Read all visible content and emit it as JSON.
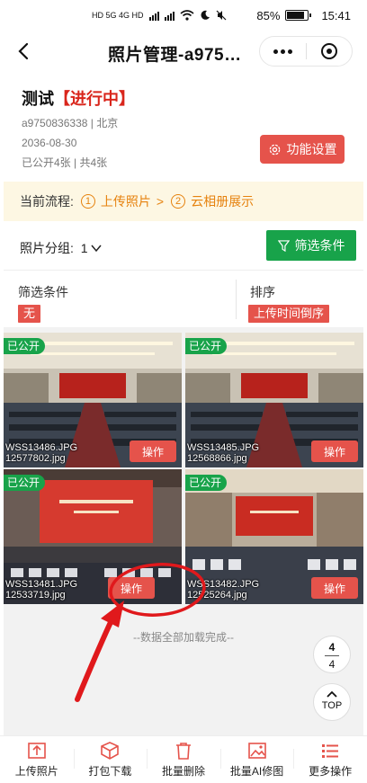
{
  "status_bar": {
    "network_left": "HD 5G 4G HD",
    "battery": "85%",
    "time": "15:41"
  },
  "nav": {
    "title": "照片管理-a975…",
    "back_icon": "chevron-left-icon",
    "more_icon": "more-dots-icon",
    "close_icon": "mini-program-close-icon"
  },
  "album": {
    "name": "测试",
    "state": "【进行中】",
    "id_location": "a9750836338 | 北京",
    "date": "2036-08-30",
    "counts": "已公开4张 | 共4张",
    "settings_label": "功能设置"
  },
  "flow": {
    "label": "当前流程:",
    "step1_num": "1",
    "step1": "上传照片",
    "arrow": ">",
    "step2_num": "2",
    "step2": "云相册展示"
  },
  "group": {
    "label": "照片分组:",
    "value": "1",
    "filter_label": "筛选条件"
  },
  "filter_header": {
    "filter_title": "筛选条件",
    "filter_value": "无",
    "sort_title": "排序",
    "sort_value": "上传时间倒序"
  },
  "photos": [
    {
      "status": "已公开",
      "line1": "WSS13486.JPG",
      "line2": "12577802.jpg",
      "action": "操作"
    },
    {
      "status": "已公开",
      "line1": "WSS13485.JPG",
      "line2": "12568866.jpg",
      "action": "操作"
    },
    {
      "status": "已公开",
      "line1": "WSS13481.JPG",
      "line2": "12533719.jpg",
      "action": "操作"
    },
    {
      "status": "已公开",
      "line1": "WSS13482.JPG",
      "line2": "12525264.jpg",
      "action": "操作"
    }
  ],
  "load_done": "--数据全部加载完成--",
  "pager": {
    "current": "4",
    "total": "4"
  },
  "top_label": "TOP",
  "tabbar": [
    {
      "label": "上传照片",
      "icon": "upload-icon"
    },
    {
      "label": "打包下载",
      "icon": "package-download-icon"
    },
    {
      "label": "批量删除",
      "icon": "trash-icon"
    },
    {
      "label": "批量AI修图",
      "icon": "ai-image-edit-icon"
    },
    {
      "label": "更多操作",
      "icon": "menu-list-icon"
    }
  ],
  "colors": {
    "accent_red": "#e5534b",
    "brand_green": "#18a34a",
    "flow_orange": "#e6820e",
    "flow_bg": "#fdf7e3"
  }
}
